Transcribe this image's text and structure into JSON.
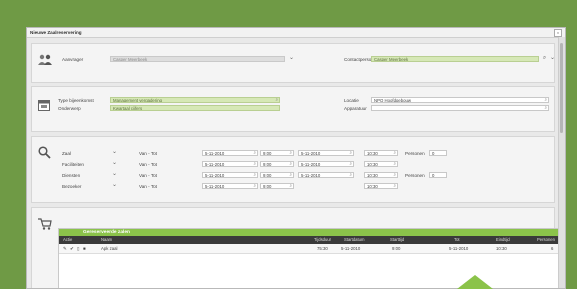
{
  "window": {
    "title": "Nieuwe Zaalreservering",
    "close": "x"
  },
  "requester": {
    "aanvrager_label": "Aanvrager",
    "aanvrager_value": "Casper Meerbeek",
    "contact_label": "Contactpersoon",
    "contact_value": "Casper Meerbeek"
  },
  "meeting": {
    "type_label": "Type bijeenkomst",
    "type_value": "Management vergadering",
    "subject_label": "Onderwerp",
    "subject_value": "Kwartaal cijfers",
    "location_label": "Locatie",
    "location_value": "NPQ Hoofdgebouw",
    "equipment_label": "Apparatuur",
    "equipment_value": ""
  },
  "rows": [
    {
      "label": "Zaal",
      "mode": "Van - Tot",
      "date_from": "5-11-2010",
      "time_from": "9:00",
      "date_to": "5-11-2010",
      "time_to": "10:30",
      "persons_label": "Personen",
      "persons_value": "0"
    },
    {
      "label": "Faciliteiten",
      "mode": "Van - Tot",
      "date_from": "5-11-2010",
      "time_from": "9:00",
      "date_to": "5-11-2010",
      "time_to": "10:30",
      "persons_label": "",
      "persons_value": ""
    },
    {
      "label": "Diensten",
      "mode": "Van - Tot",
      "date_from": "5-11-2010",
      "time_from": "9:00",
      "date_to": "5-11-2010",
      "time_to": "10:30",
      "persons_label": "Personen",
      "persons_value": "0"
    },
    {
      "label": "Bezoeker",
      "mode": "Van - Tot",
      "date_from": "5-11-2010",
      "time_from": "9:00",
      "date_to": "",
      "time_to": "10:30",
      "persons_label": "",
      "persons_value": ""
    }
  ],
  "reserved": {
    "title": "Gereserveerde zalen",
    "headers": [
      "Actie",
      "Naam",
      "Tijdsduur",
      "Startdatum",
      "Starttijd",
      "Tot",
      "Eindtijd",
      "Personen"
    ],
    "rows": [
      {
        "name": "Apk zaal",
        "duration": "75:30",
        "start_date": "5-11-2010",
        "start_time": "9:00",
        "end_date": "5-11-2010",
        "end_time": "10:30",
        "persons": "6"
      }
    ]
  },
  "colors": {
    "background": "#6f9a45",
    "accent": "#8bc34a",
    "field_green": "#d6e8b6"
  }
}
